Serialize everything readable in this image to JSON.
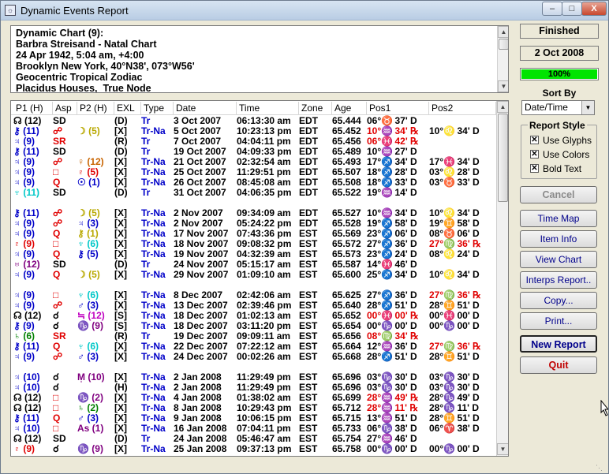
{
  "window": {
    "title": "Dynamic Events Report"
  },
  "header_lines": [
    "Dynamic Chart (9):",
    "Barbra Streisand - Natal Chart",
    "24 Apr 1942, 5:04 am, +4:00",
    "Brooklyn New York, 40°N38', 073°W56'",
    "Geocentric Tropical Zodiac",
    "Placidus Houses,  True Node"
  ],
  "columns": [
    "P1 (H)",
    "Asp",
    "P2 (H)",
    "EXL",
    "Type",
    "Date",
    "Time",
    "Zone",
    "Age",
    "Pos1",
    "Pos2"
  ],
  "colors": {
    "black": "#000000",
    "blue": "#0000c8",
    "red": "#e00000",
    "green": "#008000",
    "olive": "#b8a800",
    "cyan": "#00c8c8",
    "magenta": "#c000c0",
    "purple": "#800080",
    "orange": "#c86400",
    "teal": "#006870"
  },
  "rows": [
    {
      "p1": "☊ (12)",
      "p1c": "black",
      "asp": "SD",
      "aspc": "black",
      "p2": "",
      "p2c": "black",
      "exl": "(D)",
      "type": "Tr",
      "date": "3 Oct 2007",
      "time": "06:13:30 am",
      "zone": "EDT",
      "age": "65.444",
      "pos1": "06°♉ 37' D",
      "pos1c": "black",
      "pos2": "",
      "pos2c": "black"
    },
    {
      "p1": "⚷ (11)",
      "p1c": "blue",
      "asp": "☍",
      "aspc": "red",
      "p2": "☽ (5)",
      "p2c": "olive",
      "exl": "[X]",
      "type": "Tr-Na",
      "date": "5 Oct 2007",
      "time": "10:23:13 pm",
      "zone": "EDT",
      "age": "65.452",
      "pos1": "10°♒ 34' ℞",
      "pos1c": "red",
      "pos2": "10°♌ 34' D",
      "pos2c": "black"
    },
    {
      "p1": "♃ (9)",
      "p1c": "blue",
      "asp": "SR",
      "aspc": "red",
      "p2": "",
      "p2c": "black",
      "exl": "(R)",
      "type": "Tr",
      "date": "7 Oct 2007",
      "time": "04:04:11 pm",
      "zone": "EDT",
      "age": "65.456",
      "pos1": "06°♓ 42' ℞",
      "pos1c": "red",
      "pos2": "",
      "pos2c": "black"
    },
    {
      "p1": "⚷ (11)",
      "p1c": "blue",
      "asp": "SD",
      "aspc": "black",
      "p2": "",
      "p2c": "black",
      "exl": "(D)",
      "type": "Tr",
      "date": "19 Oct 2007",
      "time": "04:09:33 pm",
      "zone": "EDT",
      "age": "65.489",
      "pos1": "10°♒ 27' D",
      "pos1c": "black",
      "pos2": "",
      "pos2c": "black"
    },
    {
      "p1": "♃ (9)",
      "p1c": "blue",
      "asp": "☍",
      "aspc": "red",
      "p2": "♀ (12)",
      "p2c": "orange",
      "exl": "[X]",
      "type": "Tr-Na",
      "date": "21 Oct 2007",
      "time": "02:32:54 am",
      "zone": "EDT",
      "age": "65.493",
      "pos1": "17°♐ 34' D",
      "pos1c": "black",
      "pos2": "17°♓ 34' D",
      "pos2c": "black"
    },
    {
      "p1": "♃ (9)",
      "p1c": "blue",
      "asp": "□",
      "aspc": "red",
      "p2": "♇ (5)",
      "p2c": "red",
      "exl": "[X]",
      "type": "Tr-Na",
      "date": "25 Oct 2007",
      "time": "11:29:51 pm",
      "zone": "EDT",
      "age": "65.507",
      "pos1": "18°♐ 28' D",
      "pos1c": "black",
      "pos2": "03°♌ 28' D",
      "pos2c": "black"
    },
    {
      "p1": "♃ (9)",
      "p1c": "blue",
      "asp": "Q",
      "aspc": "red",
      "p2": "☉ (1)",
      "p2c": "blue",
      "exl": "[X]",
      "type": "Tr-Na",
      "date": "26 Oct 2007",
      "time": "08:45:08 am",
      "zone": "EDT",
      "age": "65.508",
      "pos1": "18°♐ 33' D",
      "pos1c": "black",
      "pos2": "03°♉ 33' D",
      "pos2c": "black"
    },
    {
      "p1": "♆ (11)",
      "p1c": "cyan",
      "asp": "SD",
      "aspc": "black",
      "p2": "",
      "p2c": "black",
      "exl": "(D)",
      "type": "Tr",
      "date": "31 Oct 2007",
      "time": "04:06:35 pm",
      "zone": "EDT",
      "age": "65.522",
      "pos1": "19°♒ 14' D",
      "pos1c": "black",
      "pos2": "",
      "pos2c": "black"
    },
    {
      "blank": true
    },
    {
      "p1": "⚷ (11)",
      "p1c": "blue",
      "asp": "☍",
      "aspc": "red",
      "p2": "☽ (5)",
      "p2c": "olive",
      "exl": "[X]",
      "type": "Tr-Na",
      "date": "2 Nov 2007",
      "time": "09:34:09 am",
      "zone": "EDT",
      "age": "65.527",
      "pos1": "10°♒ 34' D",
      "pos1c": "black",
      "pos2": "10°♌ 34' D",
      "pos2c": "black"
    },
    {
      "p1": "♃ (9)",
      "p1c": "blue",
      "asp": "☍",
      "aspc": "red",
      "p2": "♃ (3)",
      "p2c": "blue",
      "exl": "[X]",
      "type": "Tr-Na",
      "date": "2 Nov 2007",
      "time": "05:24:22 pm",
      "zone": "EDT",
      "age": "65.528",
      "pos1": "19°♐ 58' D",
      "pos1c": "black",
      "pos2": "19°♊ 58' D",
      "pos2c": "black"
    },
    {
      "p1": "♃ (9)",
      "p1c": "blue",
      "asp": "Q",
      "aspc": "red",
      "p2": "⚷ (1)",
      "p2c": "olive",
      "exl": "[X]",
      "type": "Tr-Na",
      "date": "17 Nov 2007",
      "time": "07:43:36 pm",
      "zone": "EST",
      "age": "65.569",
      "pos1": "23°♐ 06' D",
      "pos1c": "black",
      "pos2": "08°♉ 06' D",
      "pos2c": "black"
    },
    {
      "p1": "♇ (9)",
      "p1c": "red",
      "asp": "□",
      "aspc": "red",
      "p2": "♆ (6)",
      "p2c": "cyan",
      "exl": "[X]",
      "type": "Tr-Na",
      "date": "18 Nov 2007",
      "time": "09:08:32 pm",
      "zone": "EST",
      "age": "65.572",
      "pos1": "27°♐ 36' D",
      "pos1c": "black",
      "pos2": "27°♍ 36' ℞",
      "pos2c": "red"
    },
    {
      "p1": "♃ (9)",
      "p1c": "blue",
      "asp": "Q",
      "aspc": "red",
      "p2": "⚷ (5)",
      "p2c": "blue",
      "exl": "[X]",
      "type": "Tr-Na",
      "date": "19 Nov 2007",
      "time": "04:32:39 am",
      "zone": "EST",
      "age": "65.573",
      "pos1": "23°♐ 24' D",
      "pos1c": "black",
      "pos2": "08°♌ 24' D",
      "pos2c": "black"
    },
    {
      "p1": "♅ (12)",
      "p1c": "purple",
      "asp": "SD",
      "aspc": "black",
      "p2": "",
      "p2c": "black",
      "exl": "(D)",
      "type": "Tr",
      "date": "24 Nov 2007",
      "time": "05:15:17 am",
      "zone": "EST",
      "age": "65.587",
      "pos1": "14°♓ 46' D",
      "pos1c": "black",
      "pos2": "",
      "pos2c": "black"
    },
    {
      "p1": "♃ (9)",
      "p1c": "blue",
      "asp": "Q",
      "aspc": "red",
      "p2": "☽ (5)",
      "p2c": "olive",
      "exl": "[X]",
      "type": "Tr-Na",
      "date": "29 Nov 2007",
      "time": "01:09:10 am",
      "zone": "EST",
      "age": "65.600",
      "pos1": "25°♐ 34' D",
      "pos1c": "black",
      "pos2": "10°♌ 34' D",
      "pos2c": "black"
    },
    {
      "blank": true
    },
    {
      "p1": "♃ (9)",
      "p1c": "blue",
      "asp": "□",
      "aspc": "red",
      "p2": "♆ (6)",
      "p2c": "cyan",
      "exl": "[X]",
      "type": "Tr-Na",
      "date": "8 Dec 2007",
      "time": "02:42:06 am",
      "zone": "EST",
      "age": "65.625",
      "pos1": "27°♐ 36' D",
      "pos1c": "black",
      "pos2": "27°♍ 36' ℞",
      "pos2c": "red"
    },
    {
      "p1": "♃ (9)",
      "p1c": "blue",
      "asp": "☍",
      "aspc": "red",
      "p2": "♂ (3)",
      "p2c": "blue",
      "exl": "[X]",
      "type": "Tr-Na",
      "date": "13 Dec 2007",
      "time": "02:39:46 pm",
      "zone": "EST",
      "age": "65.640",
      "pos1": "28°♐ 51' D",
      "pos1c": "black",
      "pos2": "28°♊ 51' D",
      "pos2c": "black"
    },
    {
      "p1": "☊ (12)",
      "p1c": "black",
      "asp": "☌",
      "aspc": "black",
      "p2": "≒ (12)",
      "p2c": "magenta",
      "exl": "[S]",
      "type": "Tr-Na",
      "date": "18 Dec 2007",
      "time": "01:02:13 am",
      "zone": "EST",
      "age": "65.652",
      "pos1": "00°♓ 00' ℞",
      "pos1c": "red",
      "pos2": "00°♓ 00' D",
      "pos2c": "black"
    },
    {
      "p1": "⚷ (9)",
      "p1c": "blue",
      "asp": "☌",
      "aspc": "black",
      "p2": "♑ (9)",
      "p2c": "purple",
      "exl": "[S]",
      "type": "Tr-Na",
      "date": "18 Dec 2007",
      "time": "03:11:20 pm",
      "zone": "EST",
      "age": "65.654",
      "pos1": "00°♑ 00' D",
      "pos1c": "black",
      "pos2": "00°♑ 00' D",
      "pos2c": "black"
    },
    {
      "p1": "♄ (6)",
      "p1c": "green",
      "asp": "SR",
      "aspc": "red",
      "p2": "",
      "p2c": "black",
      "exl": "(R)",
      "type": "Tr",
      "date": "19 Dec 2007",
      "time": "09:09:11 am",
      "zone": "EST",
      "age": "65.656",
      "pos1": "08°♍ 34' ℞",
      "pos1c": "red",
      "pos2": "",
      "pos2c": "black"
    },
    {
      "p1": "⚷ (11)",
      "p1c": "blue",
      "asp": "Q",
      "aspc": "red",
      "p2": "♆ (6)",
      "p2c": "cyan",
      "exl": "[X]",
      "type": "Tr-Na",
      "date": "22 Dec 2007",
      "time": "07:22:12 am",
      "zone": "EST",
      "age": "65.664",
      "pos1": "12°♒ 36' D",
      "pos1c": "black",
      "pos2": "27°♍ 36' ℞",
      "pos2c": "red"
    },
    {
      "p1": "♃ (9)",
      "p1c": "blue",
      "asp": "☍",
      "aspc": "red",
      "p2": "♂ (3)",
      "p2c": "blue",
      "exl": "[X]",
      "type": "Tr-Na",
      "date": "24 Dec 2007",
      "time": "00:02:26 am",
      "zone": "EST",
      "age": "65.668",
      "pos1": "28°♐ 51' D",
      "pos1c": "black",
      "pos2": "28°♊ 51' D",
      "pos2c": "black"
    },
    {
      "blank": true
    },
    {
      "p1": "♃ (10)",
      "p1c": "blue",
      "asp": "☌",
      "aspc": "black",
      "p2": "M̩ (10)",
      "p2c": "purple",
      "exl": "[X]",
      "type": "Tr-Na",
      "date": "2 Jan 2008",
      "time": "11:29:49 pm",
      "zone": "EST",
      "age": "65.696",
      "pos1": "03°♑ 30' D",
      "pos1c": "black",
      "pos2": "03°♑ 30' D",
      "pos2c": "black"
    },
    {
      "p1": "♃ (10)",
      "p1c": "blue",
      "asp": "☌",
      "aspc": "black",
      "p2": "",
      "p2c": "black",
      "exl": "(H)",
      "type": "Tr-Na",
      "date": "2 Jan 2008",
      "time": "11:29:49 pm",
      "zone": "EST",
      "age": "65.696",
      "pos1": "03°♑ 30' D",
      "pos1c": "black",
      "pos2": "03°♑ 30' D",
      "pos2c": "black"
    },
    {
      "p1": "☊ (12)",
      "p1c": "black",
      "asp": "□",
      "aspc": "red",
      "p2": "♑ (2)",
      "p2c": "purple",
      "exl": "[X]",
      "type": "Tr-Na",
      "date": "4 Jan 2008",
      "time": "01:38:02 am",
      "zone": "EST",
      "age": "65.699",
      "pos1": "28°♒ 49' ℞",
      "pos1c": "red",
      "pos2": "28°♑ 49' D",
      "pos2c": "black"
    },
    {
      "p1": "☊ (12)",
      "p1c": "black",
      "asp": "□",
      "aspc": "red",
      "p2": "♄ (2)",
      "p2c": "green",
      "exl": "[X]",
      "type": "Tr-Na",
      "date": "8 Jan 2008",
      "time": "10:29:43 pm",
      "zone": "EST",
      "age": "65.712",
      "pos1": "28°♒ 11' ℞",
      "pos1c": "red",
      "pos2": "28°♑ 11' D",
      "pos2c": "black"
    },
    {
      "p1": "⚷ (11)",
      "p1c": "blue",
      "asp": "Q",
      "aspc": "red",
      "p2": "♂ (3)",
      "p2c": "blue",
      "exl": "[X]",
      "type": "Tr-Na",
      "date": "9 Jan 2008",
      "time": "10:06:15 pm",
      "zone": "EST",
      "age": "65.715",
      "pos1": "13°♒ 51' D",
      "pos1c": "black",
      "pos2": "28°♊ 51' D",
      "pos2c": "black"
    },
    {
      "p1": "♃ (10)",
      "p1c": "blue",
      "asp": "□",
      "aspc": "red",
      "p2": "As (1)",
      "p2c": "purple",
      "exl": "[X]",
      "type": "Tr-Na",
      "date": "16 Jan 2008",
      "time": "07:04:11 pm",
      "zone": "EST",
      "age": "65.733",
      "pos1": "06°♑ 38' D",
      "pos1c": "black",
      "pos2": "06°♈ 38' D",
      "pos2c": "black"
    },
    {
      "p1": "☊ (12)",
      "p1c": "black",
      "asp": "SD",
      "aspc": "black",
      "p2": "",
      "p2c": "black",
      "exl": "(D)",
      "type": "Tr",
      "date": "24 Jan 2008",
      "time": "05:46:47 am",
      "zone": "EST",
      "age": "65.754",
      "pos1": "27°♒ 46' D",
      "pos1c": "black",
      "pos2": "",
      "pos2c": "black"
    },
    {
      "p1": "♇ (9)",
      "p1c": "red",
      "asp": "☌",
      "aspc": "black",
      "p2": "♑ (9)",
      "p2c": "purple",
      "exl": "[X]",
      "type": "Tr-Na",
      "date": "25 Jan 2008",
      "time": "09:37:13 pm",
      "zone": "EST",
      "age": "65.758",
      "pos1": "00°♑ 00' D",
      "pos1c": "black",
      "pos2": "00°♑ 00' D",
      "pos2c": "black"
    }
  ],
  "status": "Finished",
  "current_date": "2 Oct 2008",
  "progress": {
    "percent": 100,
    "label": "100%"
  },
  "sort": {
    "label": "Sort By",
    "value": "Date/Time"
  },
  "report_style": {
    "title": "Report Style",
    "options": [
      {
        "label": "Use Glyphs",
        "checked": true
      },
      {
        "label": "Use Colors",
        "checked": true
      },
      {
        "label": "Bold Text",
        "checked": true
      }
    ]
  },
  "buttons": {
    "cancel": "Cancel",
    "time_map": "Time Map",
    "item_info": "Item Info",
    "view_chart": "View Chart",
    "interps_report": "Interps Report..",
    "copy": "Copy...",
    "print": "Print...",
    "new_report": "New Report",
    "quit": "Quit"
  },
  "caption": {
    "minimize": "–",
    "maximize": "□",
    "close": "X"
  }
}
